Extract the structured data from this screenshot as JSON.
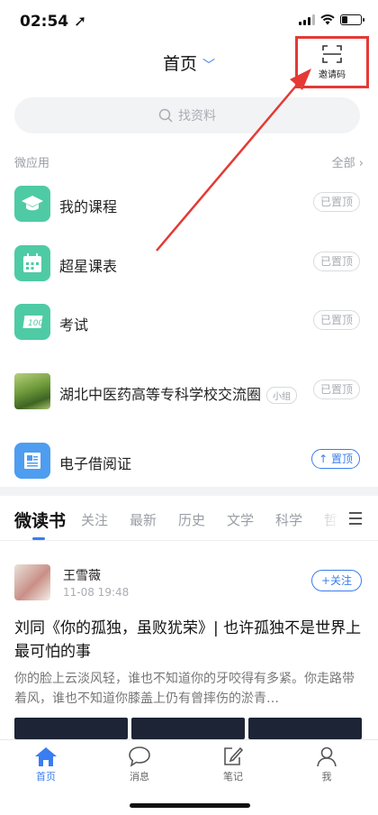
{
  "status": {
    "time": "02:54"
  },
  "header": {
    "title": "首页",
    "invite_label": "邀请码"
  },
  "search": {
    "placeholder": "找资料"
  },
  "apps_section": {
    "title": "微应用",
    "all_label": "全部"
  },
  "apps": [
    {
      "label": "我的课程",
      "pin": "已置顶",
      "icon": "graduation-cap-icon"
    },
    {
      "label": "超星课表",
      "pin": "已置顶",
      "icon": "calendar-icon"
    },
    {
      "label": "考试",
      "pin": "已置顶",
      "icon": "exam-100-icon"
    },
    {
      "label": "湖北中医药高等专科学校交流圈",
      "tag": "小组",
      "pin": "已置顶",
      "icon": "group-photo"
    },
    {
      "label": "电子借阅证",
      "pin": "置顶",
      "icon": "library-card-icon"
    }
  ],
  "tabs": [
    "微读书",
    "关注",
    "最新",
    "历史",
    "文学",
    "科学",
    "哲"
  ],
  "post": {
    "author": "王雪薇",
    "time": "11-08 19:48",
    "follow_label": "+关注",
    "title": "刘同《你的孤独，虽败犹荣》| 也许孤独不是世界上最可怕的事",
    "summary": "你的脸上云淡风轻，谁也不知道你的牙咬得有多紧。你走路带着风，谁也不知道你膝盖上仍有曾摔伤的淤青…"
  },
  "bottom_nav": [
    "首页",
    "消息",
    "笔记",
    "我"
  ],
  "colors": {
    "accent": "#3a7df0",
    "app_green": "#4ecba4",
    "annotation_red": "#e53935"
  }
}
